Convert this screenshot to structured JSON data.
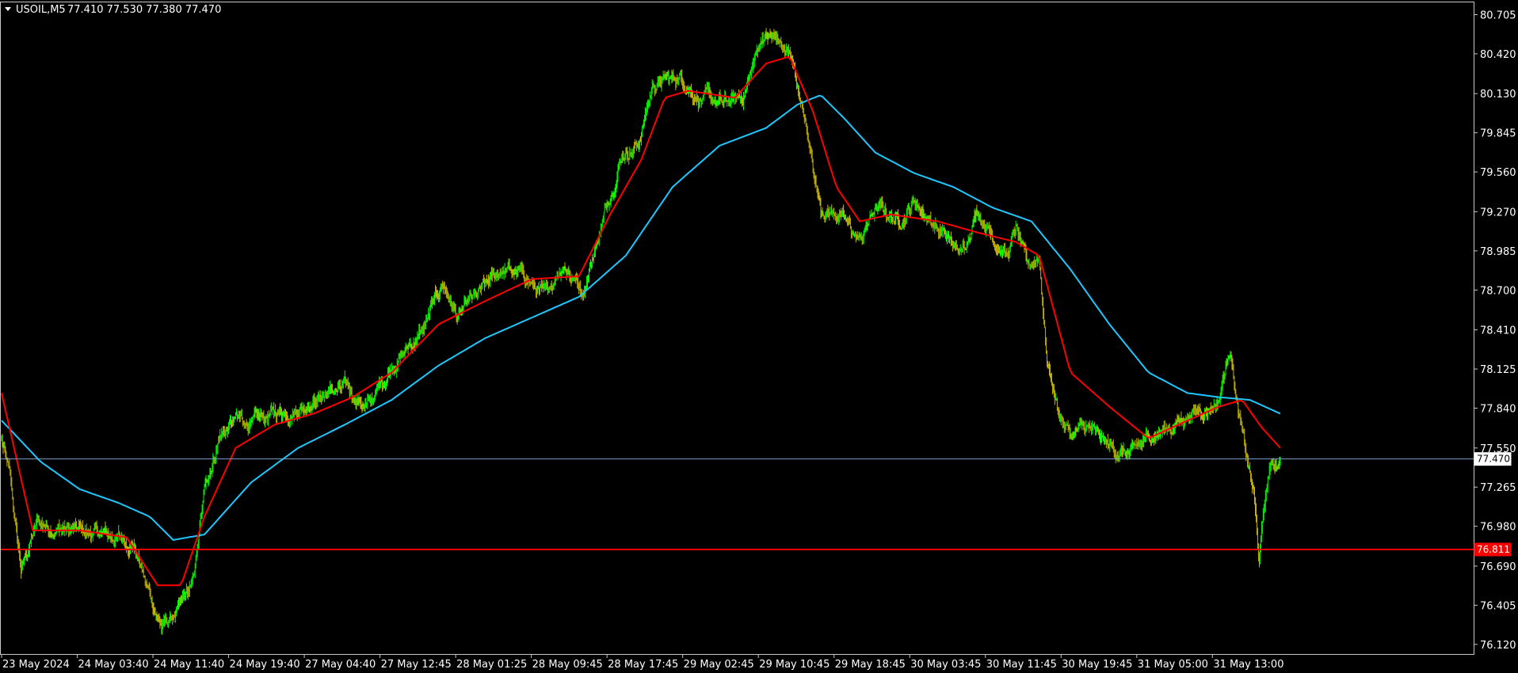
{
  "header": {
    "symbol": "USOIL,M5",
    "ohlc": "77.410 77.530 77.380 77.470"
  },
  "colors": {
    "background": "#000000",
    "frame": "#c8c8c8",
    "candle": "#00ff00",
    "candle_down": "#c8b400",
    "ma_fast": "#ff0000",
    "ma_slow": "#1ec8ff",
    "price_line": "#7aa3c9",
    "level_line": "#ff0000",
    "text": "#ffffff"
  },
  "chart_data": {
    "type": "candlestick",
    "y_axis": {
      "min": 76.05,
      "max": 80.8,
      "ticks": [
        80.705,
        80.42,
        80.13,
        79.845,
        79.56,
        79.27,
        78.985,
        78.7,
        78.41,
        78.125,
        77.84,
        77.55,
        77.265,
        76.98,
        76.69,
        76.405,
        76.12
      ],
      "tick_labels": [
        "80.705",
        "80.420",
        "80.130",
        "79.845",
        "79.560",
        "79.270",
        "78.985",
        "78.700",
        "78.410",
        "78.125",
        "77.840",
        "77.550",
        "77.265",
        "76.980",
        "76.690",
        "76.405",
        "76.120"
      ]
    },
    "x_axis": {
      "n_bars": 1640,
      "tick_labels": [
        "23 May 2024",
        "24 May 03:40",
        "24 May 11:40",
        "24 May 19:40",
        "27 May 04:40",
        "27 May 12:45",
        "28 May 01:25",
        "28 May 09:45",
        "28 May 17:45",
        "29 May 02:45",
        "29 May 10:45",
        "29 May 18:45",
        "30 May 03:45",
        "30 May 11:45",
        "30 May 19:45",
        "31 May 05:00",
        "31 May 13:00"
      ],
      "tick_index": [
        0,
        97,
        194,
        291,
        388,
        485,
        582,
        679,
        776,
        873,
        970,
        1067,
        1164,
        1261,
        1358,
        1455,
        1552
      ]
    },
    "price_anchors": [
      [
        0,
        77.6
      ],
      [
        10,
        77.35
      ],
      [
        25,
        76.65
      ],
      [
        45,
        77.0
      ],
      [
        90,
        76.95
      ],
      [
        150,
        76.9
      ],
      [
        170,
        76.85
      ],
      [
        185,
        76.55
      ],
      [
        205,
        76.25
      ],
      [
        225,
        76.35
      ],
      [
        245,
        76.55
      ],
      [
        262,
        77.3
      ],
      [
        280,
        77.65
      ],
      [
        300,
        77.75
      ],
      [
        320,
        77.72
      ],
      [
        350,
        77.8
      ],
      [
        380,
        77.85
      ],
      [
        420,
        77.95
      ],
      [
        440,
        77.98
      ],
      [
        470,
        77.85
      ],
      [
        500,
        78.15
      ],
      [
        540,
        78.4
      ],
      [
        565,
        78.75
      ],
      [
        585,
        78.5
      ],
      [
        610,
        78.65
      ],
      [
        640,
        78.85
      ],
      [
        670,
        78.8
      ],
      [
        695,
        78.65
      ],
      [
        720,
        78.9
      ],
      [
        745,
        78.7
      ],
      [
        770,
        79.2
      ],
      [
        795,
        79.7
      ],
      [
        815,
        79.75
      ],
      [
        835,
        80.2
      ],
      [
        870,
        80.25
      ],
      [
        895,
        80.1
      ],
      [
        925,
        80.05
      ],
      [
        950,
        80.1
      ],
      [
        975,
        80.55
      ],
      [
        995,
        80.52
      ],
      [
        1015,
        80.35
      ],
      [
        1030,
        79.9
      ],
      [
        1050,
        79.3
      ],
      [
        1075,
        79.25
      ],
      [
        1100,
        79.05
      ],
      [
        1120,
        79.3
      ],
      [
        1150,
        79.2
      ],
      [
        1170,
        79.35
      ],
      [
        1200,
        79.15
      ],
      [
        1230,
        78.95
      ],
      [
        1250,
        79.3
      ],
      [
        1270,
        79.1
      ],
      [
        1290,
        78.95
      ],
      [
        1300,
        79.15
      ],
      [
        1315,
        78.85
      ],
      [
        1330,
        78.95
      ],
      [
        1340,
        78.2
      ],
      [
        1355,
        77.8
      ],
      [
        1370,
        77.65
      ],
      [
        1390,
        77.7
      ],
      [
        1420,
        77.55
      ],
      [
        1450,
        77.5
      ],
      [
        1475,
        77.65
      ],
      [
        1500,
        77.7
      ],
      [
        1520,
        77.8
      ],
      [
        1545,
        77.85
      ],
      [
        1560,
        77.9
      ],
      [
        1575,
        78.3
      ],
      [
        1585,
        77.8
      ],
      [
        1595,
        77.5
      ],
      [
        1605,
        77.2
      ],
      [
        1612,
        76.72
      ],
      [
        1618,
        77.1
      ],
      [
        1625,
        77.4
      ],
      [
        1639,
        77.47
      ]
    ],
    "ma_fast_anchors": [
      [
        0,
        77.95
      ],
      [
        40,
        76.95
      ],
      [
        100,
        76.95
      ],
      [
        160,
        76.9
      ],
      [
        200,
        76.55
      ],
      [
        230,
        76.55
      ],
      [
        260,
        77.05
      ],
      [
        300,
        77.55
      ],
      [
        350,
        77.72
      ],
      [
        400,
        77.8
      ],
      [
        450,
        77.92
      ],
      [
        500,
        78.1
      ],
      [
        560,
        78.45
      ],
      [
        620,
        78.62
      ],
      [
        680,
        78.78
      ],
      [
        740,
        78.8
      ],
      [
        780,
        79.25
      ],
      [
        820,
        79.65
      ],
      [
        850,
        80.1
      ],
      [
        880,
        80.15
      ],
      [
        940,
        80.1
      ],
      [
        980,
        80.35
      ],
      [
        1010,
        80.4
      ],
      [
        1040,
        80.0
      ],
      [
        1070,
        79.45
      ],
      [
        1100,
        79.2
      ],
      [
        1140,
        79.25
      ],
      [
        1200,
        79.2
      ],
      [
        1250,
        79.12
      ],
      [
        1300,
        79.05
      ],
      [
        1330,
        78.95
      ],
      [
        1370,
        78.1
      ],
      [
        1420,
        77.85
      ],
      [
        1470,
        77.62
      ],
      [
        1520,
        77.75
      ],
      [
        1560,
        77.85
      ],
      [
        1590,
        77.9
      ],
      [
        1615,
        77.7
      ],
      [
        1639,
        77.55
      ]
    ],
    "ma_slow_anchors": [
      [
        0,
        77.75
      ],
      [
        50,
        77.45
      ],
      [
        100,
        77.25
      ],
      [
        150,
        77.15
      ],
      [
        190,
        77.05
      ],
      [
        220,
        76.88
      ],
      [
        260,
        76.92
      ],
      [
        320,
        77.3
      ],
      [
        380,
        77.55
      ],
      [
        440,
        77.72
      ],
      [
        500,
        77.9
      ],
      [
        560,
        78.15
      ],
      [
        620,
        78.35
      ],
      [
        680,
        78.5
      ],
      [
        740,
        78.65
      ],
      [
        800,
        78.95
      ],
      [
        860,
        79.45
      ],
      [
        920,
        79.75
      ],
      [
        980,
        79.88
      ],
      [
        1020,
        80.05
      ],
      [
        1050,
        80.12
      ],
      [
        1080,
        79.95
      ],
      [
        1120,
        79.7
      ],
      [
        1170,
        79.55
      ],
      [
        1220,
        79.45
      ],
      [
        1270,
        79.3
      ],
      [
        1320,
        79.2
      ],
      [
        1370,
        78.85
      ],
      [
        1420,
        78.45
      ],
      [
        1470,
        78.1
      ],
      [
        1520,
        77.95
      ],
      [
        1560,
        77.92
      ],
      [
        1600,
        77.9
      ],
      [
        1639,
        77.8
      ]
    ],
    "current_price": 77.47,
    "current_price_label": "77.470",
    "level": 76.811,
    "level_label": "76.811"
  }
}
